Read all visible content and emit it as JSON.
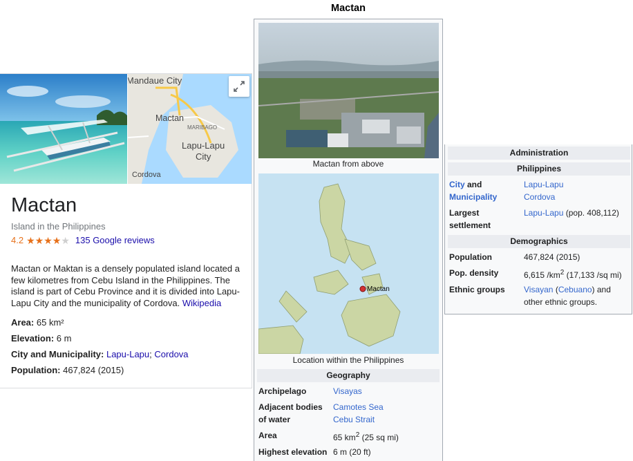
{
  "knowledge_panel": {
    "map_labels": [
      "Mandaue City",
      "Mactan",
      "MARIBAGO",
      "Lapu-Lapu",
      "City",
      "Cordova"
    ],
    "title": "Mactan",
    "subtitle": "Island in the Philippines",
    "rating": "4.2",
    "rating_fraction": 0.84,
    "reviews_link": "135 Google reviews",
    "description": "Mactan or Maktan is a densely populated island located a few kilometres from Cebu Island in the Philippines. The island is part of Cebu Province and it is divided into Lapu-Lapu City and the municipality of Cordova.",
    "description_link": "Wikipedia",
    "facts": {
      "area_label": "Area:",
      "area_value": "65 km²",
      "elevation_label": "Elevation:",
      "elevation_value": "6 m",
      "city_label": "City and Municipality:",
      "city_link1": "Lapu-Lapu",
      "city_sep": ";",
      "city_link2": "Cordova",
      "population_label": "Population:",
      "population_value": "467,824 (2015)"
    },
    "colors": {
      "link": "#1a0dab",
      "star": "#e7711b"
    }
  },
  "infobox": {
    "title": "Mactan",
    "caption1": "Mactan from above",
    "map_marker_label": "Mactan",
    "caption2": "Location within the Philippines",
    "geography_header": "Geography",
    "archipelago_label": "Archipelago",
    "archipelago_value": "Visayas",
    "adjacent_label_1": "Adjacent bodies",
    "adjacent_label_2": "of water",
    "adjacent_value_1": "Camotes Sea",
    "adjacent_value_2": "Cebu Strait",
    "area_label": "Area",
    "area_value_a": "65 km",
    "area_value_sup": "2",
    "area_value_b": " (25 sq mi)",
    "elev_label": "Highest elevation",
    "elev_value": "6 m (20 ft)"
  },
  "infobox_right": {
    "admin_header": "Administration",
    "country_header": "Philippines",
    "city_label_link": "City",
    "city_label_and": " and",
    "city_label_muni": "Municipality",
    "city_value_1": "Lapu-Lapu",
    "city_value_2": "Cordova",
    "largest_label_1": "Largest",
    "largest_label_2": "settlement",
    "largest_value_link": "Lapu-Lapu",
    "largest_value_rest": " (pop. 408,112)",
    "demographics_header": "Demographics",
    "population_label": "Population",
    "population_value": "467,824 (2015)",
    "density_label": "Pop. density",
    "density_value_a": "6,615 /km",
    "density_value_sup": "2",
    "density_value_b": " (17,133 /sq mi)",
    "ethnic_label": "Ethnic groups",
    "ethnic_link1": "Visayan",
    "ethnic_paren_open": " (",
    "ethnic_link2": "Cebuano",
    "ethnic_paren_close": ") and",
    "ethnic_rest": "other ethnic groups."
  }
}
